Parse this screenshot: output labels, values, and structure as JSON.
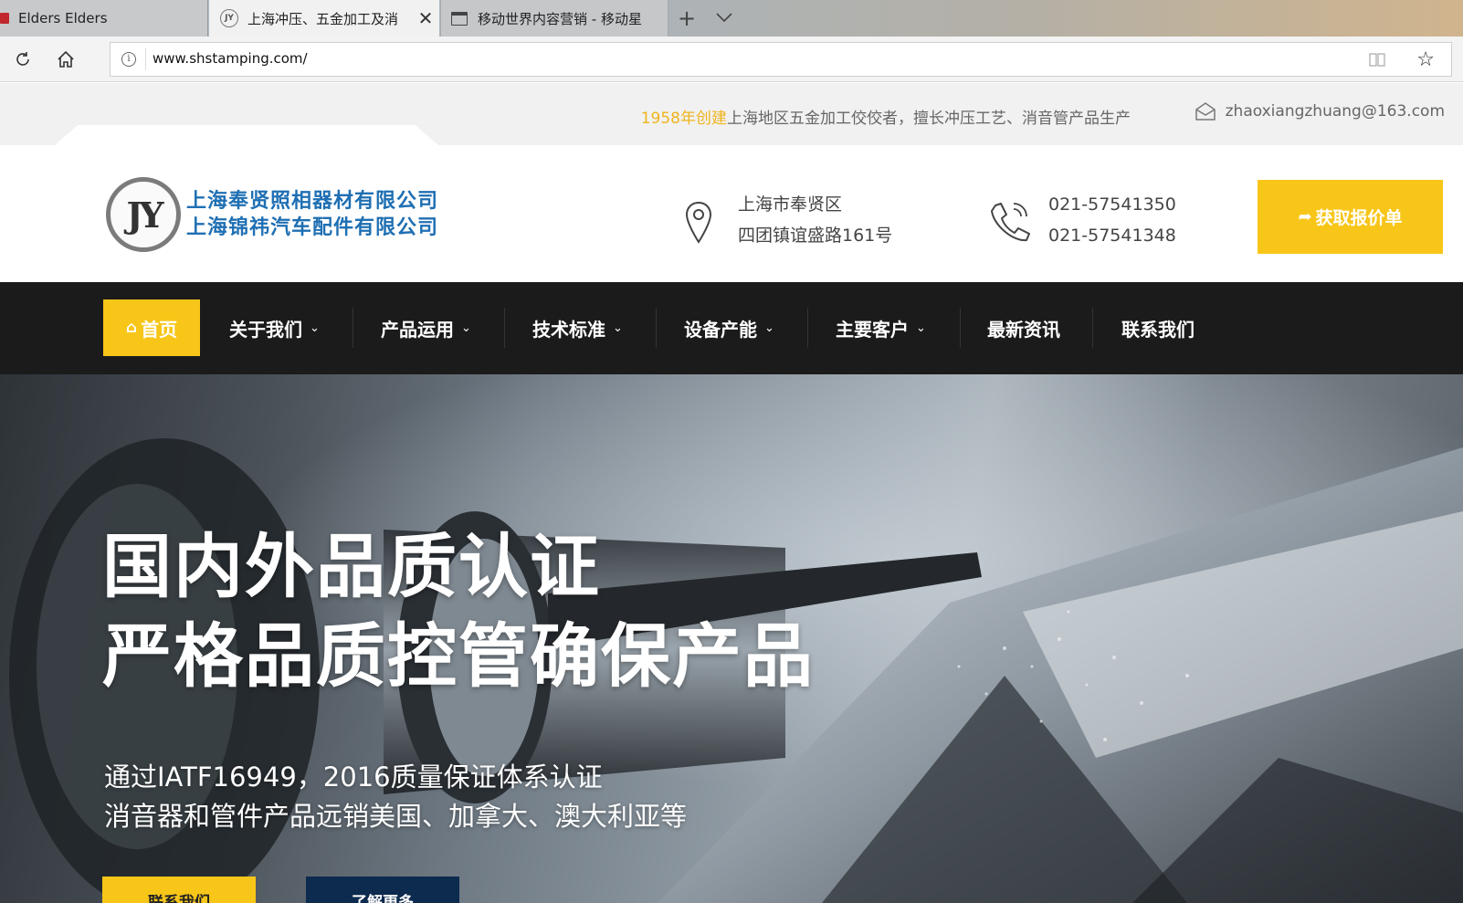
{
  "browser": {
    "tabs": [
      {
        "title": "Elders Elders"
      },
      {
        "title": "上海冲压、五金加工及消"
      },
      {
        "title": "移动世界内容营销 - 移动星"
      }
    ],
    "url": "www.shstamping.com/"
  },
  "topbar": {
    "slogan_accent": "1958年创建",
    "slogan_rest": "上海地区五金加工佼佼者，擅长冲压工艺、消音管产品生产",
    "email": "zhaoxiangzhuang@163.com"
  },
  "header": {
    "logo_mark": "JY",
    "company_1": "上海奉贤照相器材有限公司",
    "company_2": "上海锦祎汽车配件有限公司",
    "address_1": "上海市奉贤区",
    "address_2": "四团镇谊盛路161号",
    "phone_1": "021-57541350",
    "phone_2": "021-57541348",
    "quote_label": "获取报价单"
  },
  "nav": {
    "items": [
      {
        "label": "首页"
      },
      {
        "label": "关于我们"
      },
      {
        "label": "产品运用"
      },
      {
        "label": "技术标准"
      },
      {
        "label": "设备产能"
      },
      {
        "label": "主要客户"
      },
      {
        "label": "最新资讯"
      },
      {
        "label": "联系我们"
      }
    ]
  },
  "hero": {
    "title_1": "国内外品质认证",
    "title_2": "严格品质控管确保产品",
    "sub_1": "通过IATF16949，2016质量保证体系认证",
    "sub_2": "消音器和管件产品远销美国、加拿大、澳大利亚等",
    "btn_1": "联系我们",
    "btn_2": "了解更多"
  },
  "colors": {
    "accent_yellow": "#f8c619",
    "nav_dark": "#1b1b1b",
    "logo_blue": "#1f6fb3",
    "navy": "#0d2a4f"
  }
}
